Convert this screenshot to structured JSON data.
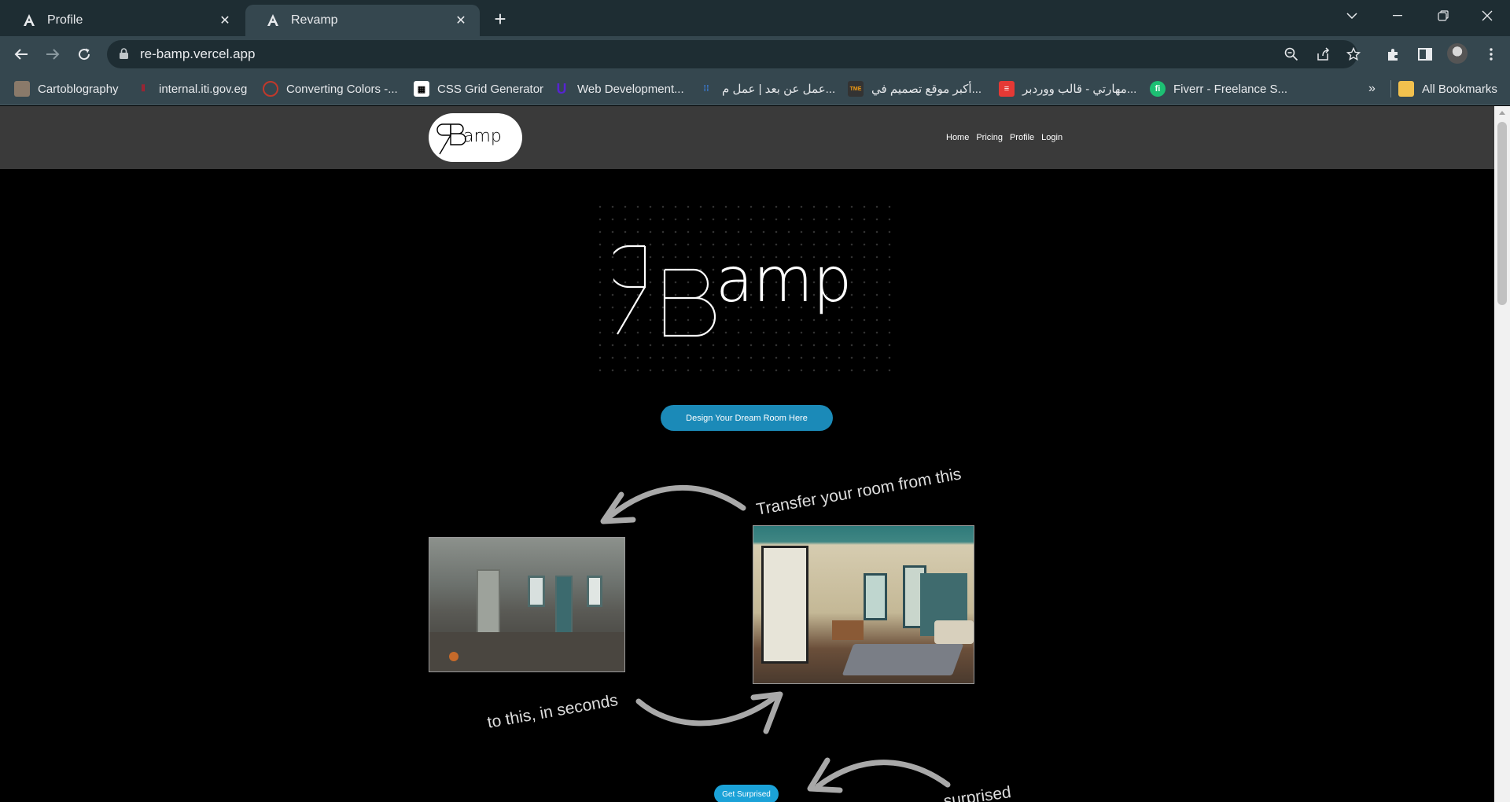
{
  "browser": {
    "tabs": [
      {
        "title": "Profile",
        "icon": "angular-icon",
        "active": false
      },
      {
        "title": "Revamp",
        "icon": "angular-icon",
        "active": true
      }
    ],
    "url": "re-bamp.vercel.app",
    "bookmarks": [
      {
        "label": "Cartoblography",
        "icon": "user-photo-icon"
      },
      {
        "label": "internal.iti.gov.eg",
        "icon": "iti-icon"
      },
      {
        "label": "Converting Colors -...",
        "icon": "color-icon"
      },
      {
        "label": "CSS Grid Generator",
        "icon": "grid-icon"
      },
      {
        "label": "Web Development...",
        "icon": "udemy-icon"
      },
      {
        "label": "عمل عن بعد | عمل م...",
        "icon": "mostaql-icon"
      },
      {
        "label": "أكبر موقع تصميم في...",
        "icon": "tme-icon"
      },
      {
        "label": "مهارتي - قالب ووردبر...",
        "icon": "maharati-icon"
      },
      {
        "label": "Fiverr - Freelance S...",
        "icon": "fiverr-icon"
      }
    ],
    "overflow_label": "»",
    "all_bookmarks_label": "All Bookmarks"
  },
  "site": {
    "logo_text": "amp",
    "nav": [
      "Home",
      "Pricing",
      "Profile",
      "Login"
    ],
    "hero_logo_text": "amp",
    "cta_label": "Design Your Dream Room Here",
    "caption_from": "Transfer your room from this",
    "caption_to": "to this, in seconds",
    "cta2_label": "Get Surprised",
    "caption_surprised": "surprised"
  },
  "colors": {
    "tab_bar": "#1e2d33",
    "toolbar": "#35474f",
    "site_nav": "#3a3a3a",
    "cta": "#1b8ab8"
  }
}
